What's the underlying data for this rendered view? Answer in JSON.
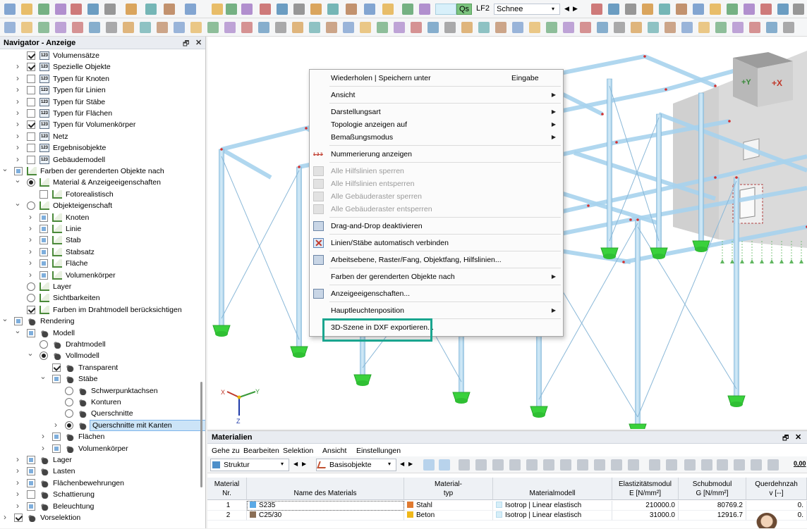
{
  "toolbar1": {
    "load_case_color_label": "Qs",
    "load_case": "LF2",
    "load_case_name": "Schnee"
  },
  "navigator": {
    "title": "Navigator - Anzeige",
    "items": [
      {
        "label": "Volumensätze",
        "indent": 2,
        "ctrl": "cb-on",
        "icon": "num",
        "arrow": ""
      },
      {
        "label": "Spezielle Objekte",
        "indent": 2,
        "ctrl": "cb-on",
        "icon": "num",
        "arrow": ">"
      },
      {
        "label": "Typen für Knoten",
        "indent": 2,
        "ctrl": "cb",
        "icon": "num",
        "arrow": ">"
      },
      {
        "label": "Typen für Linien",
        "indent": 2,
        "ctrl": "cb",
        "icon": "num",
        "arrow": ">"
      },
      {
        "label": "Typen für Stäbe",
        "indent": 2,
        "ctrl": "cb",
        "icon": "num",
        "arrow": ">"
      },
      {
        "label": "Typen für Flächen",
        "indent": 2,
        "ctrl": "cb",
        "icon": "num",
        "arrow": ">"
      },
      {
        "label": "Typen für Volumenkörper",
        "indent": 2,
        "ctrl": "cb-on",
        "icon": "num",
        "arrow": ">"
      },
      {
        "label": "Netz",
        "indent": 2,
        "ctrl": "cb",
        "icon": "num",
        "arrow": ">"
      },
      {
        "label": "Ergebnisobjekte",
        "indent": 2,
        "ctrl": "cb",
        "icon": "num",
        "arrow": ">"
      },
      {
        "label": "Gebäudemodell",
        "indent": 2,
        "ctrl": "cb",
        "icon": "num",
        "arrow": ">"
      },
      {
        "label": "Farben der gerenderten Objekte nach",
        "indent": 1,
        "ctrl": "cb-sq",
        "icon": "chart",
        "arrow": "v"
      },
      {
        "label": "Material & Anzeigeeigenschaften",
        "indent": 2,
        "ctrl": "rd-on",
        "icon": "chart",
        "arrow": "v"
      },
      {
        "label": "Fotorealistisch",
        "indent": 3,
        "ctrl": "cb",
        "icon": "chart",
        "arrow": ""
      },
      {
        "label": "Objekteigenschaft",
        "indent": 2,
        "ctrl": "rd",
        "icon": "chart",
        "arrow": "v"
      },
      {
        "label": "Knoten",
        "indent": 3,
        "ctrl": "cb-sq",
        "icon": "chart",
        "arrow": ">"
      },
      {
        "label": "Linie",
        "indent": 3,
        "ctrl": "cb-sq",
        "icon": "chart",
        "arrow": ">"
      },
      {
        "label": "Stab",
        "indent": 3,
        "ctrl": "cb-sq",
        "icon": "chart",
        "arrow": ">"
      },
      {
        "label": "Stabsatz",
        "indent": 3,
        "ctrl": "cb-sq",
        "icon": "chart",
        "arrow": ">"
      },
      {
        "label": "Fläche",
        "indent": 3,
        "ctrl": "cb-sq",
        "icon": "chart",
        "arrow": ">"
      },
      {
        "label": "Volumenkörper",
        "indent": 3,
        "ctrl": "cb-sq",
        "icon": "chart",
        "arrow": ">"
      },
      {
        "label": "Layer",
        "indent": 2,
        "ctrl": "rd",
        "icon": "chart",
        "arrow": ""
      },
      {
        "label": "Sichtbarkeiten",
        "indent": 2,
        "ctrl": "rd",
        "icon": "chart",
        "arrow": ""
      },
      {
        "label": "Farben im Drahtmodell berücksichtigen",
        "indent": 2,
        "ctrl": "cb-on",
        "icon": "chart",
        "arrow": ""
      },
      {
        "label": "Rendering",
        "indent": 1,
        "ctrl": "cb-sq",
        "icon": "pot",
        "arrow": "v"
      },
      {
        "label": "Modell",
        "indent": 2,
        "ctrl": "cb-sq",
        "icon": "pot",
        "arrow": "v"
      },
      {
        "label": "Drahtmodell",
        "indent": 3,
        "ctrl": "rd",
        "icon": "pot",
        "arrow": ""
      },
      {
        "label": "Vollmodell",
        "indent": 3,
        "ctrl": "rd-on",
        "icon": "pot",
        "arrow": "v"
      },
      {
        "label": "Transparent",
        "indent": 4,
        "ctrl": "cb-on",
        "icon": "pot",
        "arrow": ""
      },
      {
        "label": "Stäbe",
        "indent": 4,
        "ctrl": "cb-sq",
        "icon": "pot",
        "arrow": "v"
      },
      {
        "label": "Schwerpunktachsen",
        "indent": 5,
        "ctrl": "rd",
        "icon": "pot",
        "arrow": ""
      },
      {
        "label": "Konturen",
        "indent": 5,
        "ctrl": "rd",
        "icon": "pot",
        "arrow": ""
      },
      {
        "label": "Querschnitte",
        "indent": 5,
        "ctrl": "rd",
        "icon": "pot",
        "arrow": ""
      },
      {
        "label": "Querschnitte mit Kanten",
        "indent": 5,
        "ctrl": "rd-on",
        "icon": "pot",
        "arrow": ">",
        "selected": true
      },
      {
        "label": "Flächen",
        "indent": 4,
        "ctrl": "cb-sq",
        "icon": "pot",
        "arrow": ">"
      },
      {
        "label": "Volumenkörper",
        "indent": 4,
        "ctrl": "cb-sq",
        "icon": "pot",
        "arrow": ">"
      },
      {
        "label": "Lager",
        "indent": 2,
        "ctrl": "cb-sq",
        "icon": "pot",
        "arrow": ">"
      },
      {
        "label": "Lasten",
        "indent": 2,
        "ctrl": "cb-sq",
        "icon": "pot",
        "arrow": ">"
      },
      {
        "label": "Flächenbewehrungen",
        "indent": 2,
        "ctrl": "cb-sq",
        "icon": "pot",
        "arrow": ">"
      },
      {
        "label": "Schattierung",
        "indent": 2,
        "ctrl": "cb",
        "icon": "pot",
        "arrow": ">"
      },
      {
        "label": "Beleuchtung",
        "indent": 2,
        "ctrl": "cb-sq",
        "icon": "pot",
        "arrow": ">"
      },
      {
        "label": "Vorselektion",
        "indent": 1,
        "ctrl": "cb-on",
        "icon": "pot",
        "arrow": ">"
      }
    ]
  },
  "context_menu": {
    "items": [
      {
        "label": "Wiederholen | Speichern unter",
        "shortcut": "Eingabe",
        "sub": false,
        "disabled": false,
        "icon": ""
      },
      {
        "sep": true
      },
      {
        "label": "Ansicht",
        "sub": true,
        "disabled": false,
        "icon": ""
      },
      {
        "sep": true
      },
      {
        "label": "Darstellungsart",
        "sub": true,
        "disabled": false,
        "icon": ""
      },
      {
        "label": "Topologie anzeigen auf",
        "sub": true,
        "disabled": false,
        "icon": ""
      },
      {
        "label": "Bemaßungsmodus",
        "sub": true,
        "disabled": false,
        "icon": ""
      },
      {
        "sep": true
      },
      {
        "label": "Nummerierung anzeigen",
        "sub": false,
        "disabled": false,
        "icon": "numbering-icon"
      },
      {
        "sep": true
      },
      {
        "label": "Alle Hilfslinien sperren",
        "sub": false,
        "disabled": true,
        "icon": "lock-guideline-icon"
      },
      {
        "label": "Alle Hilfslinien entsperren",
        "sub": false,
        "disabled": true,
        "icon": "unlock-guideline-icon"
      },
      {
        "label": "Alle Gebäuderaster sperren",
        "sub": false,
        "disabled": true,
        "icon": "lock-grid-icon"
      },
      {
        "label": "Alle Gebäuderaster entsperren",
        "sub": false,
        "disabled": true,
        "icon": "unlock-grid-icon"
      },
      {
        "sep": true
      },
      {
        "label": "Drag-and-Drop deaktivieren",
        "sub": false,
        "disabled": false,
        "icon": "drag-drop-icon"
      },
      {
        "sep": true
      },
      {
        "label": "Linien/Stäbe automatisch verbinden",
        "sub": false,
        "disabled": false,
        "icon": "connect-lines-icon"
      },
      {
        "sep": true
      },
      {
        "label": "Arbeitsebene, Raster/Fang, Objektfang, Hilfslinien...",
        "sub": false,
        "disabled": false,
        "icon": "work-plane-icon"
      },
      {
        "sep": true
      },
      {
        "label": "Farben der gerenderten Objekte nach",
        "sub": true,
        "disabled": false,
        "icon": ""
      },
      {
        "sep": true
      },
      {
        "label": "Anzeigeeigenschaften...",
        "sub": false,
        "disabled": false,
        "icon": "display-properties-icon"
      },
      {
        "sep": true
      },
      {
        "label": "Hauptleuchtenposition",
        "sub": true,
        "disabled": false,
        "icon": ""
      },
      {
        "sep": true
      },
      {
        "label": "3D-Szene in DXF exportieren...",
        "sub": false,
        "disabled": false,
        "icon": ""
      }
    ]
  },
  "view_cube": {
    "face_y": "+Y",
    "face_x": "+X"
  },
  "axes": {
    "x": "X",
    "y": "Y",
    "z": "Z"
  },
  "materials_pane": {
    "title": "Materialien",
    "menu": [
      "Gehe zu",
      "Bearbeiten",
      "Selektion",
      "Ansicht",
      "Einstellungen"
    ],
    "structure_combo": "Struktur",
    "objects_combo": "Basisobjekte",
    "zero_label": "0,00",
    "columns": [
      {
        "l1": "Material",
        "l2": "Nr."
      },
      {
        "l1": "",
        "l2": "Name des Materials"
      },
      {
        "l1": "Material-",
        "l2": "typ"
      },
      {
        "l1": "",
        "l2": "Materialmodell"
      },
      {
        "l1": "Elastizitätsmodul",
        "l2": "E [N/mm²]"
      },
      {
        "l1": "Schubmodul",
        "l2": "G [N/mm²]"
      },
      {
        "l1": "Querdehnzah",
        "l2": "v [--]"
      }
    ],
    "rows": [
      {
        "nr": "1",
        "name": "S235",
        "name_color": "#5aa9e6",
        "type": "Stahl",
        "type_color": "#e07a30",
        "model": "Isotrop | Linear elastisch",
        "model_color": "#d6eef8",
        "e": "210000.0",
        "g": "80769.2",
        "v": "0."
      },
      {
        "nr": "2",
        "name": "C25/30",
        "name_color": "#8a6e55",
        "type": "Beton",
        "type_color": "#f0b81a",
        "model": "Isotrop | Linear elastisch",
        "model_color": "#d6eef8",
        "e": "31000.0",
        "g": "12916.7",
        "v": "0."
      }
    ]
  }
}
